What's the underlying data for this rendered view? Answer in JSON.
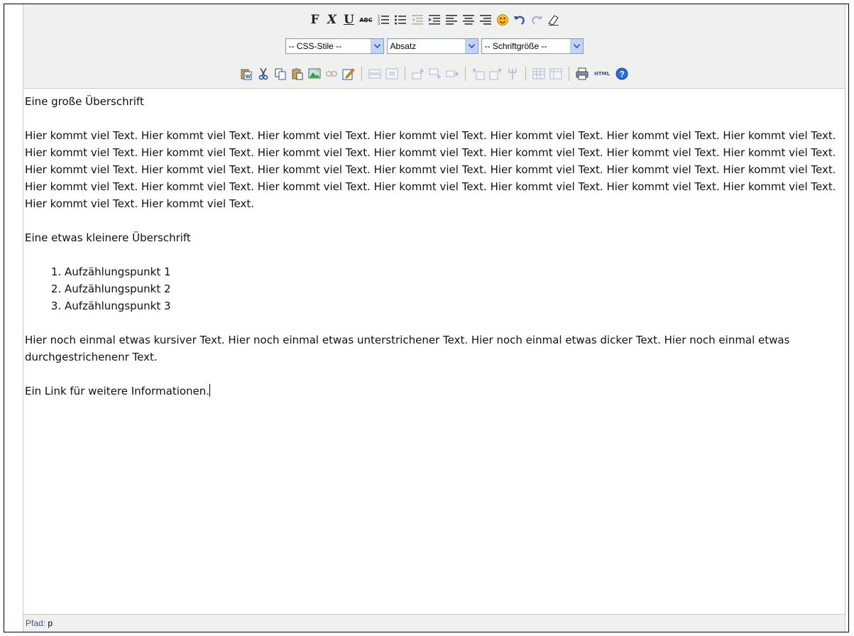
{
  "toolbar": {
    "row1": {
      "bold": "F",
      "italic": "X",
      "underline": "U",
      "strike": "ABC"
    },
    "row2": {
      "css_styles": "-- CSS-Stile --",
      "format": "Absatz",
      "font_size": "-- Schriftgröße --"
    },
    "row3": {
      "html_label": "HTML"
    }
  },
  "content": {
    "heading1": "Eine große Überschrift",
    "paragraph1": "Hier kommt viel Text. Hier kommt viel Text. Hier kommt viel Text. Hier kommt viel Text. Hier kommt viel Text. Hier kommt viel Text. Hier kommt viel Text. Hier kommt viel Text. Hier kommt viel Text. Hier kommt viel Text. Hier kommt viel Text. Hier kommt viel Text. Hier kommt viel Text. Hier kommt viel Text. Hier kommt viel Text. Hier kommt viel Text. Hier kommt viel Text. Hier kommt viel Text. Hier kommt viel Text. Hier kommt viel Text. Hier kommt viel Text. Hier kommt viel Text. Hier kommt viel Text. Hier kommt viel Text. Hier kommt viel Text. Hier kommt viel Text. Hier kommt viel Text. Hier kommt viel Text. Hier kommt viel Text. Hier kommt viel Text.",
    "heading2": "Eine etwas kleinere Überschrift",
    "list": [
      "Aufzählungspunkt 1",
      "Aufzählungspunkt 2",
      "Aufzählungspunkt 3"
    ],
    "paragraph2": "Hier noch einmal etwas kursiver Text. Hier noch einmal etwas unterstrichener Text. Hier noch einmal etwas dicker Text. Hier noch einmal etwas durchgestrichenenr Text.",
    "paragraph3": "Ein Link für weitere Informationen."
  },
  "status": {
    "label": "Pfad:",
    "path": "p"
  },
  "colors": {
    "toolbar_bg": "#f0f0ee",
    "border": "#c9c9c9",
    "select_border": "#7f9db9",
    "select_arrow": "#c1d3fb",
    "status_label": "#3a5a9a"
  }
}
